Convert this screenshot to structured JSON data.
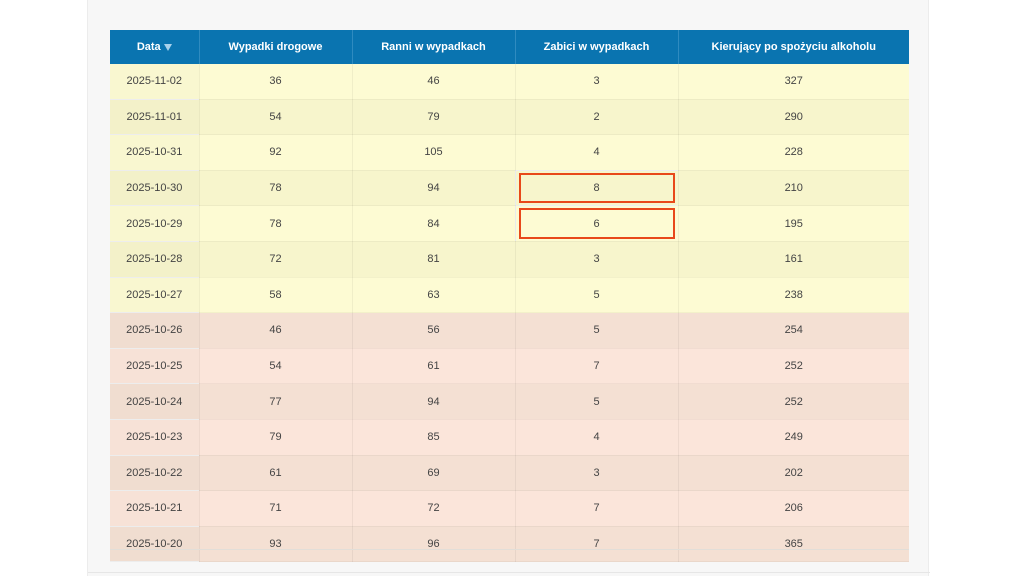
{
  "table": {
    "headers": [
      "Data",
      "Wypadki drogowe",
      "Ranni w wypadkach",
      "Zabici w wypadkach",
      "Kierujący po spożyciu alkoholu"
    ],
    "sort_icon": "sort-desc-icon",
    "rows": [
      [
        "2025-11-02",
        "36",
        "46",
        "3",
        "327"
      ],
      [
        "2025-11-01",
        "54",
        "79",
        "2",
        "290"
      ],
      [
        "2025-10-31",
        "92",
        "105",
        "4",
        "228"
      ],
      [
        "2025-10-30",
        "78",
        "94",
        "8",
        "210"
      ],
      [
        "2025-10-29",
        "78",
        "84",
        "6",
        "195"
      ],
      [
        "2025-10-28",
        "72",
        "81",
        "3",
        "161"
      ],
      [
        "2025-10-27",
        "58",
        "63",
        "5",
        "238"
      ],
      [
        "2025-10-26",
        "46",
        "56",
        "5",
        "254"
      ],
      [
        "2025-10-25",
        "54",
        "61",
        "7",
        "252"
      ],
      [
        "2025-10-24",
        "77",
        "94",
        "5",
        "252"
      ],
      [
        "2025-10-23",
        "79",
        "85",
        "4",
        "249"
      ],
      [
        "2025-10-22",
        "61",
        "69",
        "3",
        "202"
      ],
      [
        "2025-10-21",
        "71",
        "72",
        "7",
        "206"
      ],
      [
        "2025-10-20",
        "93",
        "96",
        "7",
        "365"
      ]
    ]
  },
  "colors": {
    "header_bg": "#0a74b0",
    "week_recent_bg": "#fdfbd3",
    "week_previous_bg": "#fbe5da",
    "highlight_border": "#e8481a"
  }
}
